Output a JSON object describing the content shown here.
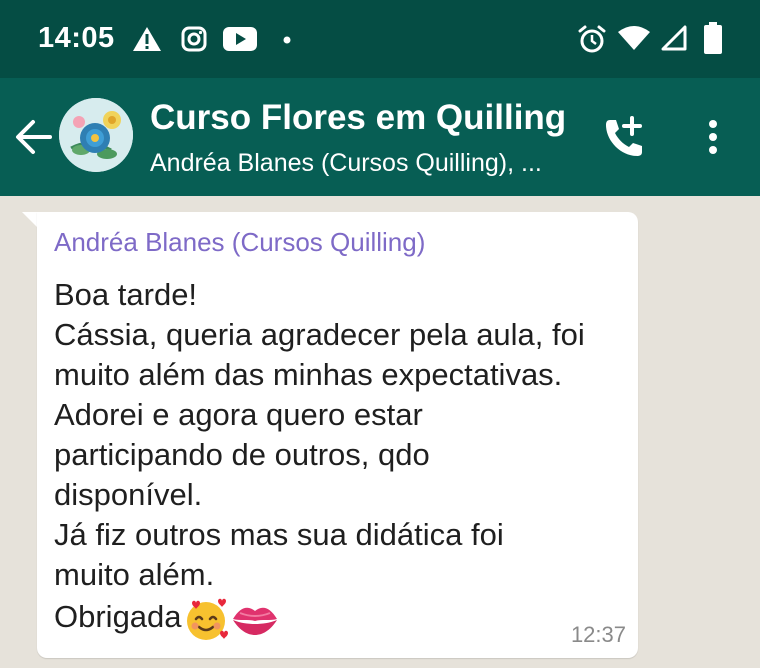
{
  "status_bar": {
    "time": "14:05",
    "left_icons": [
      "warning-icon",
      "instagram-icon",
      "youtube-icon",
      "notification-dot-icon"
    ],
    "right_icons": [
      "alarm-icon",
      "wifi-icon",
      "cell-signal-icon",
      "battery-icon"
    ]
  },
  "header": {
    "title": "Curso Flores em Quilling",
    "subtitle": "Andréa Blanes (Cursos Quilling), ...",
    "background": "#075e54",
    "status_background": "#054d44"
  },
  "message": {
    "sender": "Andréa Blanes (Cursos Quilling)",
    "sender_color": "#7e6ac7",
    "lines": [
      "Boa tarde!",
      "Cássia, queria agradecer pela aula, foi",
      "muito além das minhas expectativas.",
      "Adorei e agora quero estar",
      "participando de outros, qdo",
      "disponível.",
      "Já fiz outros mas sua didática foi",
      "muito além."
    ],
    "last_line": "Obrigada",
    "emojis": [
      "smiling-face-with-hearts-emoji",
      "kiss-mark-emoji"
    ],
    "time": "12:37"
  },
  "colors": {
    "chat_background": "#e6e2da",
    "bubble": "#ffffff"
  }
}
